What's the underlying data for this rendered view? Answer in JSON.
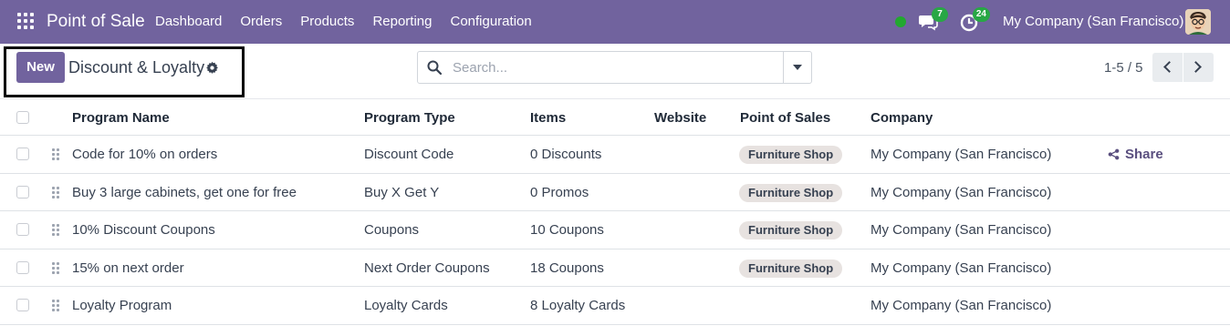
{
  "navbar": {
    "app_title": "Point of Sale",
    "menu": [
      "Dashboard",
      "Orders",
      "Products",
      "Reporting",
      "Configuration"
    ],
    "messages_count": "7",
    "activities_count": "24",
    "company": "My Company (San Francisco)",
    "colors": {
      "bar": "#71639e",
      "online": "#22a82f",
      "badge": "#28a745"
    }
  },
  "control_panel": {
    "new_label": "New",
    "breadcrumb": "Discount & Loyalty",
    "search_placeholder": "Search...",
    "pager": "1-5 / 5"
  },
  "table": {
    "columns": [
      "Program Name",
      "Program Type",
      "Items",
      "Website",
      "Point of Sales",
      "Company"
    ],
    "rows": [
      {
        "name": "Code for 10% on orders",
        "type": "Discount Code",
        "items": "0 Discounts",
        "website": "",
        "pos": "Furniture Shop",
        "company": "My Company (San Francisco)",
        "share": "Share"
      },
      {
        "name": "Buy 3 large cabinets, get one for free",
        "type": "Buy X Get Y",
        "items": "0 Promos",
        "website": "",
        "pos": "Furniture Shop",
        "company": "My Company (San Francisco)"
      },
      {
        "name": "10% Discount Coupons",
        "type": "Coupons",
        "items": "10 Coupons",
        "website": "",
        "pos": "Furniture Shop",
        "company": "My Company (San Francisco)"
      },
      {
        "name": "15% on next order",
        "type": "Next Order Coupons",
        "items": "18 Coupons",
        "website": "",
        "pos": "Furniture Shop",
        "company": "My Company (San Francisco)"
      },
      {
        "name": "Loyalty Program",
        "type": "Loyalty Cards",
        "items": "8 Loyalty Cards",
        "website": "",
        "pos": "",
        "company": "My Company (San Francisco)"
      }
    ]
  }
}
